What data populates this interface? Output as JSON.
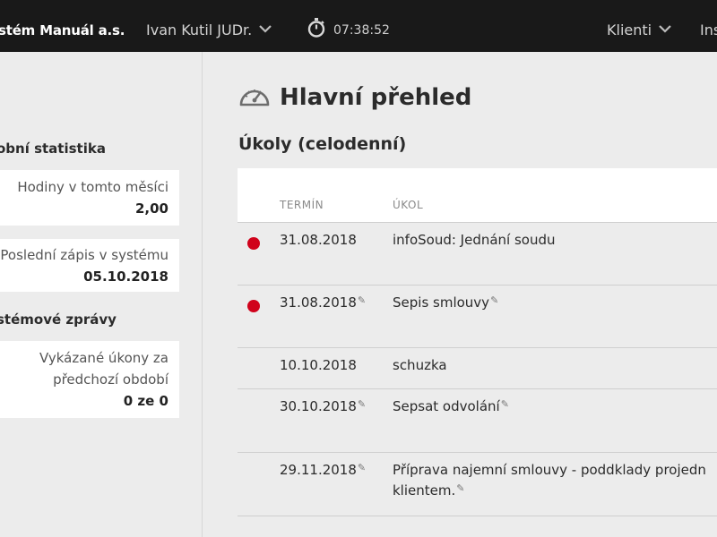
{
  "topbar": {
    "app_name": "stém Manuál a.s.",
    "user_name": "Ivan Kutil JUDr.",
    "timer_value": "07:38:52",
    "clients_label": "Klienti",
    "ins_label": "Ins"
  },
  "sidebar": {
    "personal_stats_heading": "obní statistika",
    "hours_label": "Hodiny v tomto měsíci",
    "hours_value": "2,00",
    "last_entry_label": "Poslední zápis v systému",
    "last_entry_value": "05.10.2018",
    "system_messages_heading": "stémové zprávy",
    "reported_line1": "Vykázané úkony za",
    "reported_line2": "předchozí období",
    "reported_value": "0 ze 0"
  },
  "main": {
    "title": "Hlavní přehled",
    "section_title": "Úkoly (celodenní)",
    "columns": {
      "date": "TERMÍN",
      "task": "ÚKOL"
    },
    "tasks": [
      {
        "date": "31.08.2018",
        "task": "infoSoud: Jednání soudu",
        "status": "overdue",
        "date_edit": false,
        "task_edit": false
      },
      {
        "date": "31.08.2018",
        "task": "Sepis smlouvy",
        "status": "overdue",
        "date_edit": true,
        "task_edit": true
      },
      {
        "date": "10.10.2018",
        "task": "schuzka",
        "status": "none",
        "date_edit": false,
        "task_edit": false
      },
      {
        "date": "30.10.2018",
        "task": "Sepsat odvolání",
        "status": "none",
        "date_edit": true,
        "task_edit": true
      },
      {
        "date": "29.11.2018",
        "task_line1": "Příprava najemní smlouvy - poddklady projedn",
        "task_line2": "klientem.",
        "status": "none",
        "date_edit": true,
        "task_edit": true
      }
    ]
  },
  "colors": {
    "topbar_bg": "#191919",
    "overdue_dot": "#d0021b",
    "page_bg": "#ececec"
  }
}
